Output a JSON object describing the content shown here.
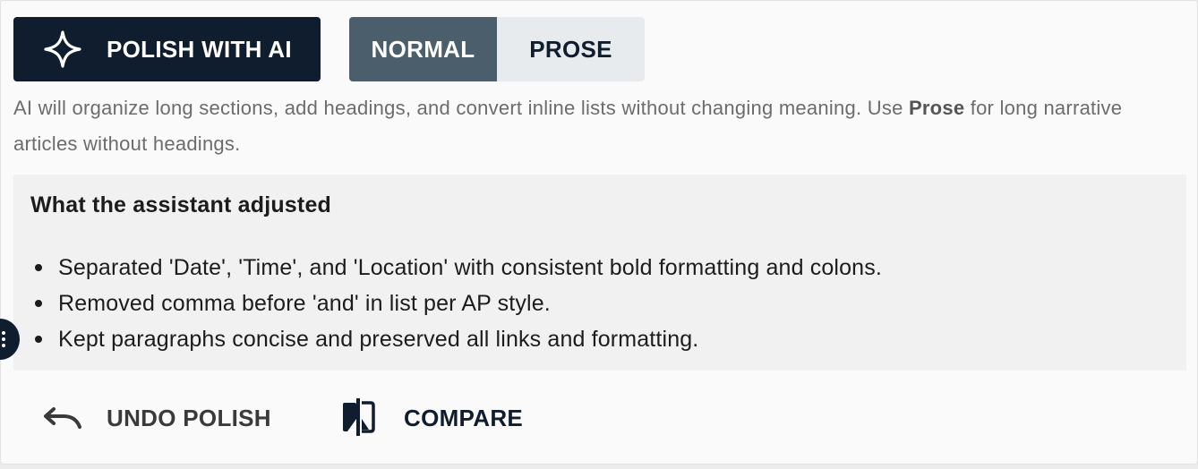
{
  "toolbar": {
    "polish_label": "POLISH WITH AI",
    "polish_icon": "sparkle-icon",
    "modes": [
      {
        "label": "NORMAL",
        "active": true
      },
      {
        "label": "PROSE",
        "active": false
      }
    ]
  },
  "hint": {
    "before": "AI will organize long sections, add headings, and convert inline lists without changing meaning. Use ",
    "emphasis": "Prose",
    "after": " for long narrative articles without headings."
  },
  "adjustments": {
    "title": "What the assistant adjusted",
    "items": [
      "Separated 'Date', 'Time', and 'Location' with consistent bold formatting and colons.",
      "Removed comma before 'and' in list per AP style.",
      "Kept paragraphs concise and preserved all links and formatting."
    ]
  },
  "actions": {
    "undo_label": "UNDO POLISH",
    "undo_icon": "undo-icon",
    "compare_label": "COMPARE",
    "compare_icon": "compare-icon"
  },
  "colors": {
    "primary_dark": "#101d2e",
    "toggle_active": "#4a5f6b",
    "toggle_inactive": "#e8ebee",
    "panel_bg": "#fafafa",
    "adjusted_bg": "#f1f1f1"
  }
}
